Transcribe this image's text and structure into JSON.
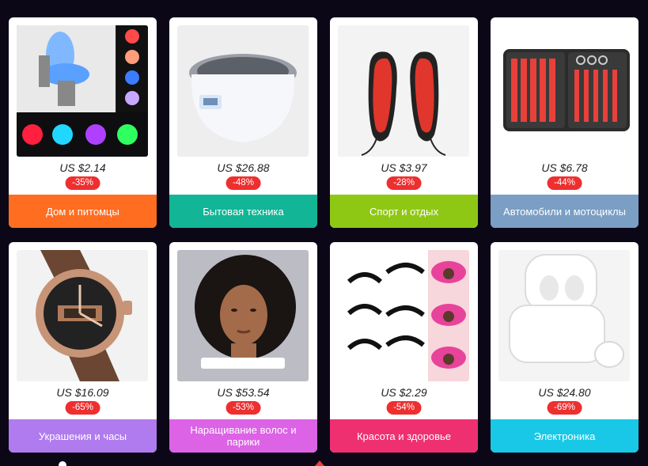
{
  "products": [
    {
      "price": "US $2.14",
      "discount": "-35%",
      "category": "Дом и питомцы",
      "color": "#ff6d21",
      "image": "toilet-night-light"
    },
    {
      "price": "US $26.88",
      "discount": "-48%",
      "category": "Бытовая техника",
      "color": "#12b596",
      "image": "ultrasonic-cleaner"
    },
    {
      "price": "US $3.97",
      "discount": "-28%",
      "category": "Спорт и отдых",
      "color": "#8fc814",
      "image": "heated-insoles"
    },
    {
      "price": "US $6.78",
      "discount": "-44%",
      "category": "Автомобили и мотоциклы",
      "color": "#7a9ec4",
      "image": "car-tool-kit"
    },
    {
      "price": "US $16.09",
      "discount": "-65%",
      "category": "Украшения и часы",
      "color": "#b07bee",
      "image": "wrist-watch"
    },
    {
      "price": "US $53.54",
      "discount": "-53%",
      "category": "Наращивание волос и парики",
      "color": "#dc62e6",
      "image": "curly-wig"
    },
    {
      "price": "US $2.29",
      "discount": "-54%",
      "category": "Красота и здоровье",
      "color": "#ef3070",
      "image": "false-eyelashes"
    },
    {
      "price": "US $24.80",
      "discount": "-69%",
      "category": "Электроника",
      "color": "#18c8e6",
      "image": "wireless-earbuds"
    }
  ]
}
